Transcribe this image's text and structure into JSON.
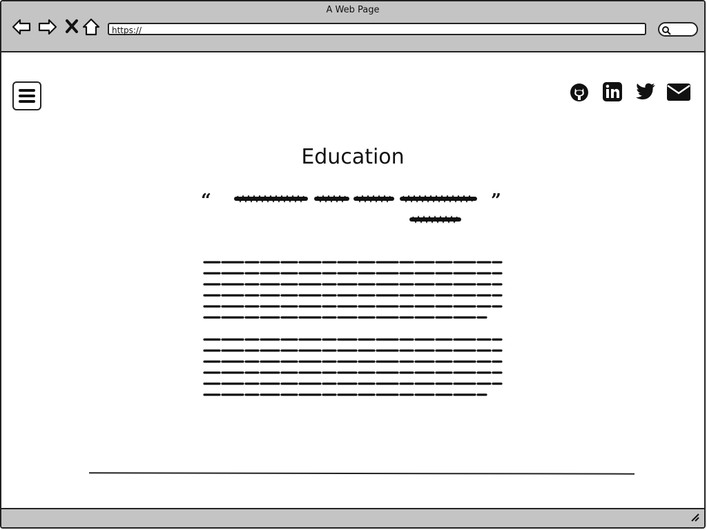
{
  "browser": {
    "window_title": "A Web Page",
    "url": "https://"
  },
  "nav_icons": [
    "back-arrow-icon",
    "forward-arrow-icon",
    "stop-icon",
    "home-icon"
  ],
  "social_icons": [
    "github-icon",
    "linkedin-icon",
    "twitter-icon",
    "email-icon"
  ],
  "page": {
    "heading": "Education"
  }
}
